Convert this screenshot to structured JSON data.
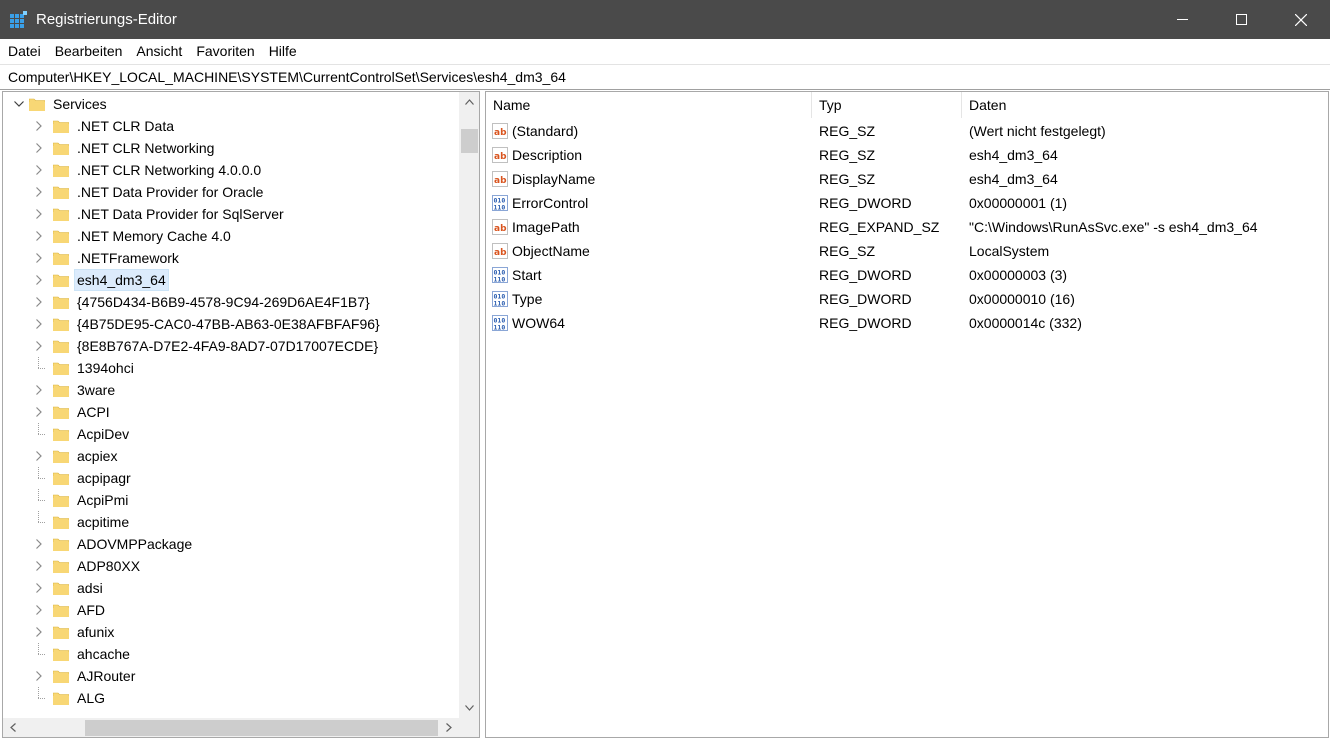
{
  "window": {
    "title": "Registrierungs-Editor",
    "minimize_glyph": "—",
    "maximize_glyph": "☐",
    "close_glyph": "✕"
  },
  "menu": [
    "Datei",
    "Bearbeiten",
    "Ansicht",
    "Favoriten",
    "Hilfe"
  ],
  "address": "Computer\\HKEY_LOCAL_MACHINE\\SYSTEM\\CurrentControlSet\\Services\\esh4_dm3_64",
  "tree": {
    "root": "Services",
    "items": [
      {
        "label": ".NET CLR Data",
        "expandable": true
      },
      {
        "label": ".NET CLR Networking",
        "expandable": true
      },
      {
        "label": ".NET CLR Networking 4.0.0.0",
        "expandable": true
      },
      {
        "label": ".NET Data Provider for Oracle",
        "expandable": true
      },
      {
        "label": ".NET Data Provider for SqlServer",
        "expandable": true
      },
      {
        "label": ".NET Memory Cache 4.0",
        "expandable": true
      },
      {
        "label": ".NETFramework",
        "expandable": true
      },
      {
        "label": "esh4_dm3_64",
        "expandable": true,
        "selected": true
      },
      {
        "label": "{4756D434-B6B9-4578-9C94-269D6AE4F1B7}",
        "expandable": true
      },
      {
        "label": "{4B75DE95-CAC0-47BB-AB63-0E38AFBFAF96}",
        "expandable": true
      },
      {
        "label": "{8E8B767A-D7E2-4FA9-8AD7-07D17007ECDE}",
        "expandable": true
      },
      {
        "label": "1394ohci",
        "expandable": false
      },
      {
        "label": "3ware",
        "expandable": true
      },
      {
        "label": "ACPI",
        "expandable": true
      },
      {
        "label": "AcpiDev",
        "expandable": false
      },
      {
        "label": "acpiex",
        "expandable": true
      },
      {
        "label": "acpipagr",
        "expandable": false
      },
      {
        "label": "AcpiPmi",
        "expandable": false
      },
      {
        "label": "acpitime",
        "expandable": false
      },
      {
        "label": "ADOVMPPackage",
        "expandable": true
      },
      {
        "label": "ADP80XX",
        "expandable": true
      },
      {
        "label": "adsi",
        "expandable": true
      },
      {
        "label": "AFD",
        "expandable": true
      },
      {
        "label": "afunix",
        "expandable": true
      },
      {
        "label": "ahcache",
        "expandable": false
      },
      {
        "label": "AJRouter",
        "expandable": true
      },
      {
        "label": "ALG",
        "expandable": false
      }
    ]
  },
  "values": {
    "headers": {
      "name": "Name",
      "type": "Typ",
      "data": "Daten"
    },
    "rows": [
      {
        "name": "(Standard)",
        "type": "REG_SZ",
        "data": "(Wert nicht festgelegt)",
        "icon": "string"
      },
      {
        "name": "Description",
        "type": "REG_SZ",
        "data": "esh4_dm3_64",
        "icon": "string"
      },
      {
        "name": "DisplayName",
        "type": "REG_SZ",
        "data": "esh4_dm3_64",
        "icon": "string"
      },
      {
        "name": "ErrorControl",
        "type": "REG_DWORD",
        "data": "0x00000001 (1)",
        "icon": "binary"
      },
      {
        "name": "ImagePath",
        "type": "REG_EXPAND_SZ",
        "data": "\"C:\\Windows\\RunAsSvc.exe\" -s esh4_dm3_64",
        "icon": "string"
      },
      {
        "name": "ObjectName",
        "type": "REG_SZ",
        "data": "LocalSystem",
        "icon": "string"
      },
      {
        "name": "Start",
        "type": "REG_DWORD",
        "data": "0x00000003 (3)",
        "icon": "binary"
      },
      {
        "name": "Type",
        "type": "REG_DWORD",
        "data": "0x00000010 (16)",
        "icon": "binary"
      },
      {
        "name": "WOW64",
        "type": "REG_DWORD",
        "data": "0x0000014c (332)",
        "icon": "binary"
      }
    ]
  },
  "colors": {
    "titlebar": "#4a4a4a",
    "selection": "#dcebfc",
    "folder": "#f8d775",
    "string_icon": "#d9541e",
    "binary_icon": "#2a5db0"
  }
}
